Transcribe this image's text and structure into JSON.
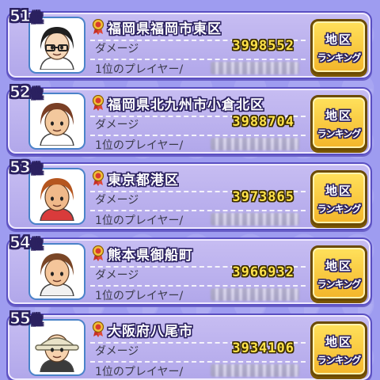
{
  "rankings": [
    {
      "rank": "51",
      "rank_suffix": "位",
      "area": "福岡県福岡市東区",
      "damage_label": "ダメージ",
      "damage": "3998552",
      "player_label": "1位のプレイヤー/",
      "button_line1": "地区",
      "button_line2": "ランキング",
      "avatar": {
        "skin": "#f6d7b8",
        "hair": "#1f1f1f",
        "shirt": "#ffffff",
        "bg": "#ffffff",
        "glasses": true,
        "hat": false
      }
    },
    {
      "rank": "52",
      "rank_suffix": "位",
      "area": "福岡県北九州市小倉北区",
      "damage_label": "ダメージ",
      "damage": "3988704",
      "player_label": "1位のプレイヤー/",
      "button_line1": "地区",
      "button_line2": "ランキング",
      "avatar": {
        "skin": "#f3c89d",
        "hair": "#7a3f25",
        "shirt": "#ffffff",
        "bg": "#ffffff",
        "glasses": false,
        "hat": false
      }
    },
    {
      "rank": "53",
      "rank_suffix": "位",
      "area": "東京都港区",
      "damage_label": "ダメージ",
      "damage": "3973865",
      "player_label": "1位のプレイヤー/",
      "button_line1": "地区",
      "button_line2": "ランキング",
      "avatar": {
        "skin": "#f0b98a",
        "hair": "#b5561f",
        "shirt": "#d93b3b",
        "bg": "#ffffff",
        "glasses": false,
        "hat": false
      }
    },
    {
      "rank": "54",
      "rank_suffix": "位",
      "area": "熊本県御船町",
      "damage_label": "ダメージ",
      "damage": "3966932",
      "player_label": "1位のプレイヤー/",
      "button_line1": "地区",
      "button_line2": "ランキング",
      "avatar": {
        "skin": "#f4c59a",
        "hair": "#7a4626",
        "shirt": "#f1f1f1",
        "bg": "#ffffff",
        "glasses": false,
        "hat": false
      }
    },
    {
      "rank": "55",
      "rank_suffix": "位",
      "area": "大阪府八尾市",
      "damage_label": "ダメージ",
      "damage": "3934106",
      "player_label": "1位のプレイヤー/",
      "button_line1": "地区",
      "button_line2": "ランキング",
      "avatar": {
        "skin": "#f6d2ae",
        "hair": "#e9e3c8",
        "shirt": "#3b3b3b",
        "bg": "#ffffff",
        "glasses": false,
        "hat": true
      }
    }
  ],
  "colors": {
    "background": "#9e9cf0",
    "card": "#bdb3ef",
    "card_border": "#5a4fc2",
    "damage_value": "#ffe24a",
    "button": "#f7c532",
    "avatar_frame": "#4b83c9",
    "medal": "#d83a2e"
  },
  "icons": {
    "medal": "medal-icon",
    "avatar": "player-avatar"
  }
}
